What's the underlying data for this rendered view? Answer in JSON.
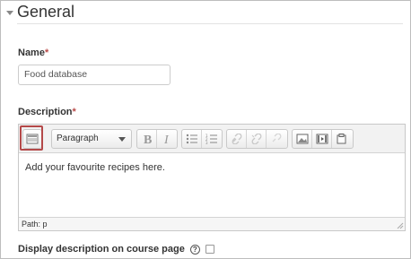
{
  "section": {
    "title": "General"
  },
  "name_field": {
    "label": "Name",
    "required_mark": "*",
    "value": "Food database"
  },
  "description_field": {
    "label": "Description",
    "required_mark": "*"
  },
  "editor": {
    "format_select": "Paragraph",
    "content": "Add your favourite recipes here.",
    "path": "Path: p",
    "toolbar_icons": [
      "toolbar-toggle-icon",
      "bold-icon",
      "italic-icon",
      "unordered-list-icon",
      "ordered-list-icon",
      "link-icon",
      "unlink-icon",
      "anchor-icon",
      "image-icon",
      "media-icon",
      "paste-icon"
    ]
  },
  "display_option": {
    "label": "Display description on course page",
    "help": "?"
  },
  "colors": {
    "required": "#b94a48",
    "highlight": "#b44949"
  }
}
